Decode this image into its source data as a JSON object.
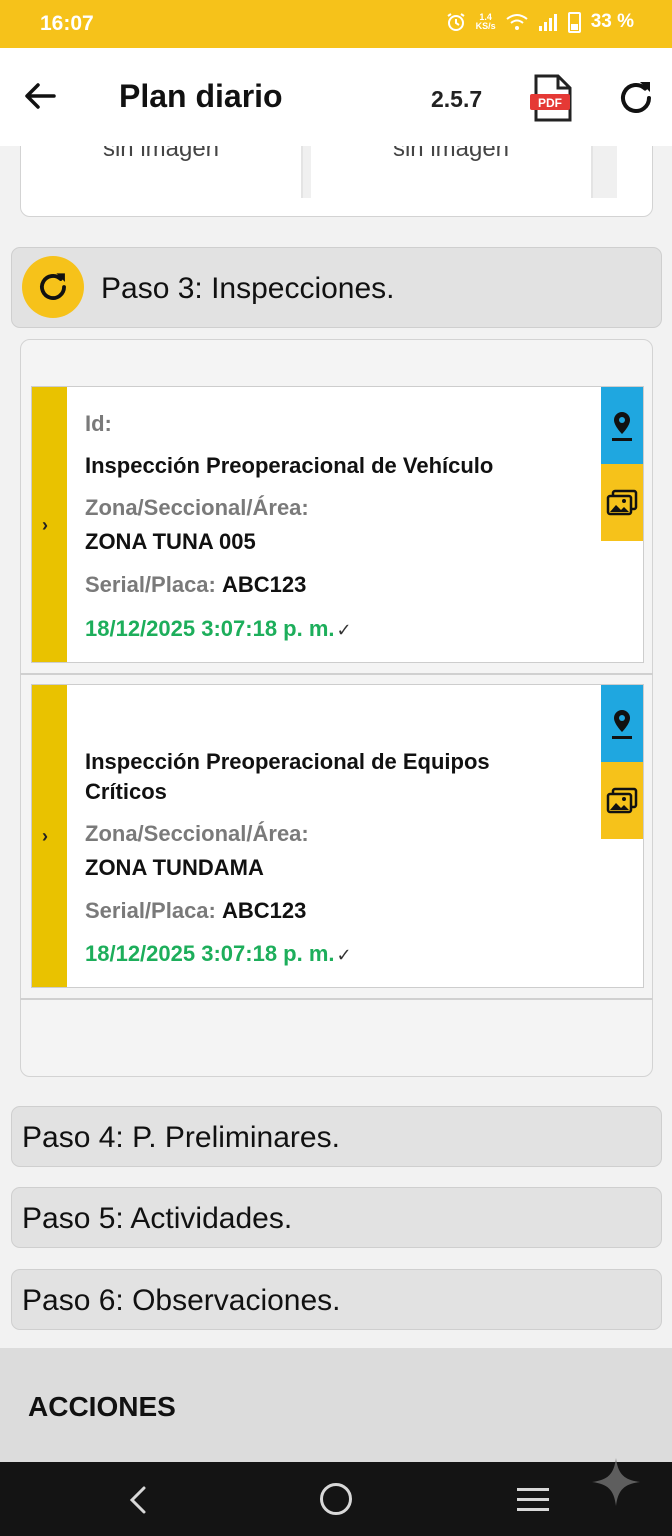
{
  "status_bar": {
    "time": "16:07",
    "net_speed_top": "1.4",
    "net_speed_bottom": "KS/s",
    "battery": "33 %"
  },
  "app_bar": {
    "title": "Plan diario",
    "version": "2.5.7",
    "pdf_label": "PDF"
  },
  "images": {
    "thumb_1": "sin imagen",
    "thumb_2": "sin imagen"
  },
  "steps": {
    "step3": "Paso 3: Inspecciones.",
    "step4": "Paso 4: P. Preliminares.",
    "step5": "Paso 5: Actividades.",
    "step6": "Paso 6: Observaciones."
  },
  "inspections": [
    {
      "id_label": "Id:",
      "title": "Inspección Preoperacional de Vehículo",
      "zone_label": "Zona/Seccional/Área:",
      "zone": "ZONA TUNA 005",
      "serial_label": "Serial/Placa:",
      "serial": "ABC123",
      "date": "18/12/2025 3:07:18 p. m."
    },
    {
      "title_line_1": "Inspección Preoperacional de Equipos",
      "title_line_2": "Críticos",
      "zone_label": "Zona/Seccional/Área:",
      "zone": "ZONA TUNDAMA",
      "serial_label": "Serial/Placa:",
      "serial": "ABC123",
      "date": "18/12/2025 3:07:18 p. m."
    }
  ],
  "actions": {
    "label": "ACCIONES"
  },
  "colors": {
    "accent": "#f6c21a",
    "strip": "#e9c200",
    "location": "#1fa7e0",
    "date_green": "#1dae5b"
  }
}
